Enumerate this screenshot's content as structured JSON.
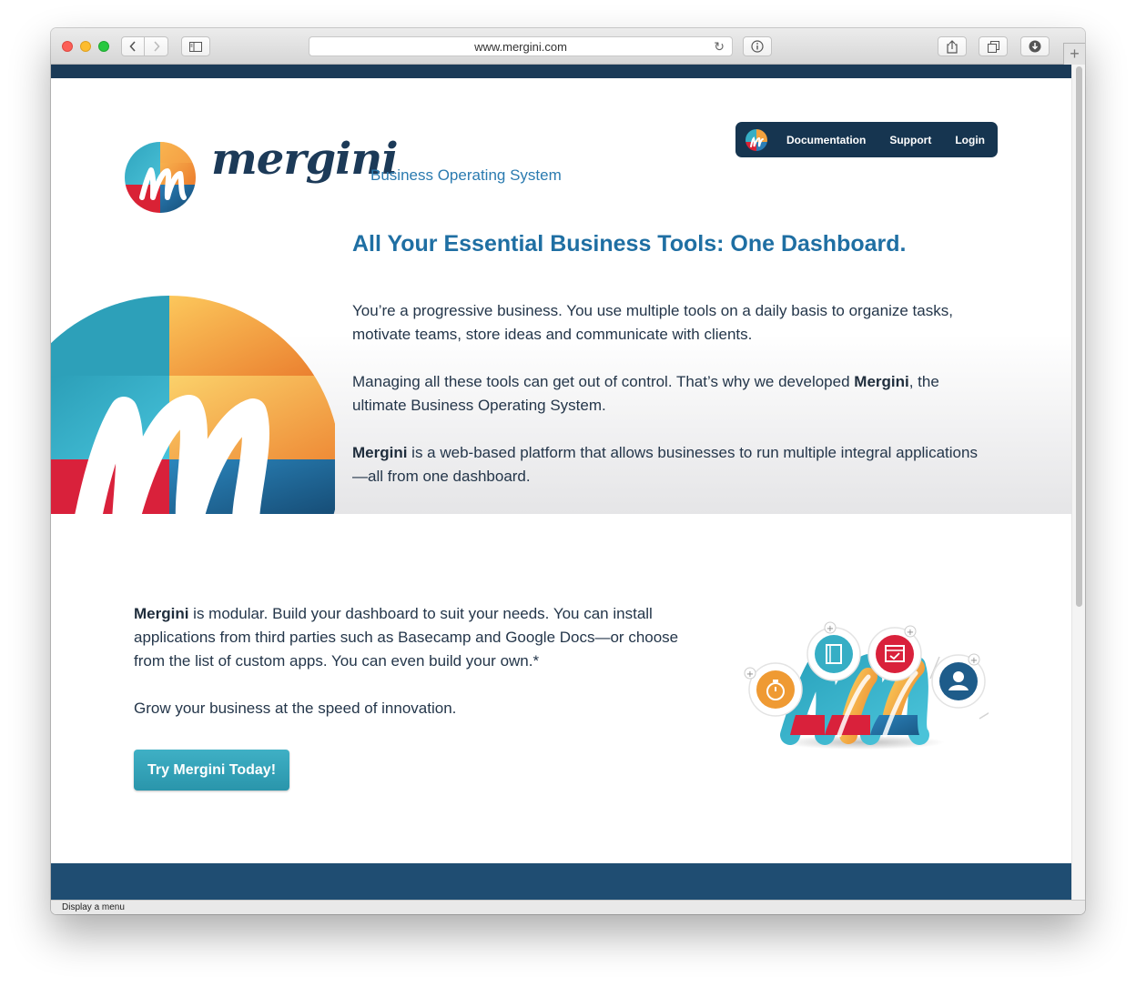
{
  "browser": {
    "url": "www.mergini.com",
    "status_text": "Display a menu"
  },
  "header": {
    "wordmark": "mergini",
    "tagline": "Business Operating System",
    "nav": [
      {
        "label": "Documentation"
      },
      {
        "label": "Support"
      },
      {
        "label": "Login"
      }
    ]
  },
  "hero": {
    "title": "All Your Essential Business Tools: One Dashboard.",
    "p1": "You’re a progressive business. You use multiple tools on a daily basis to organize tasks, motivate teams, store ideas and communicate with clients.",
    "p2_before": "Managing all these tools can get out of control. That’s why we developed ",
    "p2_bold": "Mergini",
    "p2_after": ", the ultimate Business Operating System.",
    "p3_bold": "Mergini",
    "p3_after": " is a web-based platform that allows businesses to run multiple integral applications—all from one dashboard."
  },
  "modular": {
    "p1_bold": "Mergini",
    "p1_after": " is modular. Build your dashboard to suit your needs. You can install applications from third parties such as Basecamp and Google Docs—or choose from the list of custom apps. You can even build your own.*",
    "p2": "Grow your business at the speed of innovation.",
    "cta_label": "Try Mergini Today!",
    "app_icons": [
      "stopwatch-icon",
      "notebook-icon",
      "calendar-icon",
      "user-icon"
    ]
  },
  "colors": {
    "navy": "#163550",
    "brand_blue": "#2b7bb0",
    "teal": "#3fb0c5",
    "orange": "#f0a13b",
    "red": "#d9233c"
  }
}
